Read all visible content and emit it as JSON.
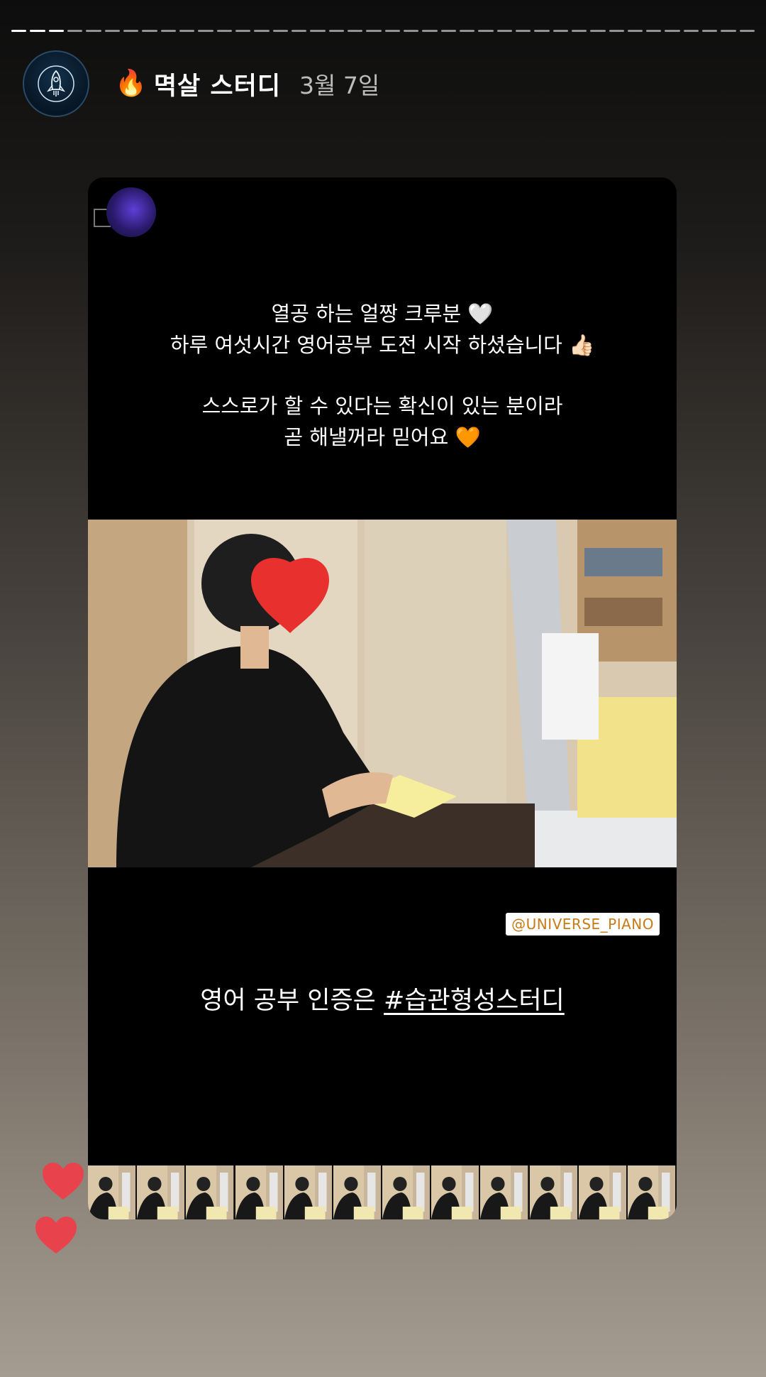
{
  "story": {
    "progress_segments_total": 40,
    "progress_segments_done": 3,
    "account": {
      "name": "멱살 스터디",
      "emoji": "🔥",
      "date": "3월 7일",
      "avatar_icon": "rocket-icon"
    },
    "shared_post": {
      "caption_top": [
        "열공 하는 얼짱 크루분 🤍",
        "하루 여섯시간 영어공부 도전 시작 하셨습니다 👍🏻"
      ],
      "caption_middle": [
        "스스로가 할 수 있다는 확신이 있는 분이라",
        "곧 해낼꺼라 믿어요 🧡"
      ],
      "mention_tag": "@UNIVERSE_PIANO",
      "caption_bottom_prefix": "영어 공부 인증은 ",
      "caption_bottom_hashtag": "#습관형성스터디"
    },
    "reactions": [
      "heart-icon",
      "heart-icon"
    ],
    "colors": {
      "heart": "#e8434d",
      "tag_text": "#c77a16"
    }
  }
}
